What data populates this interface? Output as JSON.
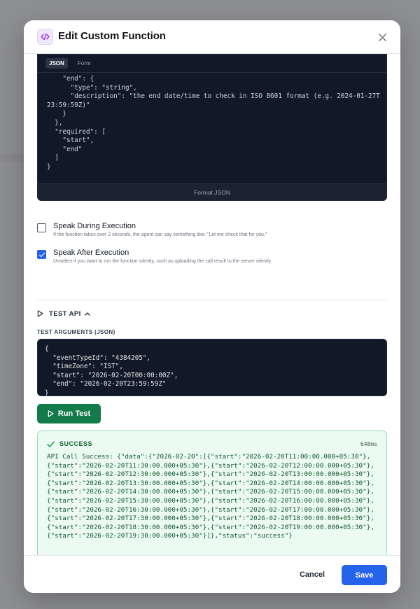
{
  "dialog": {
    "title": "Edit Custom Function",
    "icon": "code-icon",
    "accent": "#9333ea"
  },
  "schema_editor": {
    "tabs": [
      {
        "label": "JSON",
        "active": true
      },
      {
        "label": "Form",
        "active": false
      }
    ],
    "code": "    \"end\": {\n      \"type\": \"string\",\n      \"description\": \"the end date/time to check in ISO 8601 format (e.g. 2024-01-27T23:59:59Z)\"\n    }\n  },\n  \"required\": [\n    \"start\",\n    \"end\"\n  ]\n}",
    "format_label": "Format JSON"
  },
  "options": [
    {
      "label": "Speak During Execution",
      "description": "If the function takes over 2 seconds, the agent can say something like: \"Let me check that for you.\"",
      "checked": false
    },
    {
      "label": "Speak After Execution",
      "description": "Unselect if you want to run the function silently, such as uploading the call result to the server silently.",
      "checked": true
    }
  ],
  "test_api": {
    "toggle_label": "TEST API",
    "args_label": "TEST ARGUMENTS (JSON)",
    "args_code": "{\n  \"eventTypeId\": \"4384205\",\n  \"timeZone\": \"IST\",\n  \"start\": \"2026-02-20T00:00:00Z\",\n  \"end\": \"2026-02-20T23:59:59Z\"\n}",
    "run_label": "Run Test",
    "result": {
      "status": "SUCCESS",
      "duration": "648ms",
      "body": "API Call Success: {\"data\":{\"2026-02-20\":[{\"start\":\"2026-02-20T11:00:00.000+05:30\"},{\"start\":\"2026-02-20T11:30:00.000+05:30\"},{\"start\":\"2026-02-20T12:00:00.000+05:30\"},{\"start\":\"2026-02-20T12:30:00.000+05:30\"},{\"start\":\"2026-02-20T13:00:00.000+05:30\"},{\"start\":\"2026-02-20T13:30:00.000+05:30\"},{\"start\":\"2026-02-20T14:00:00.000+05:30\"},{\"start\":\"2026-02-20T14:30:00.000+05:30\"},{\"start\":\"2026-02-20T15:00:00.000+05:30\"},{\"start\":\"2026-02-20T15:30:00.000+05:30\"},{\"start\":\"2026-02-20T16:00:00.000+05:30\"},{\"start\":\"2026-02-20T16:30:00.000+05:30\"},{\"start\":\"2026-02-20T17:00:00.000+05:30\"},{\"start\":\"2026-02-20T17:30:00.000+05:30\"},{\"start\":\"2026-02-20T18:00:00.000+05:30\"},{\"start\":\"2026-02-20T18:30:00.000+05:30\"},{\"start\":\"2026-02-20T19:00:00.000+05:30\"},{\"start\":\"2026-02-20T19:30:00.000+05:30\"}]},\"status\":\"success\"}"
    }
  },
  "footer": {
    "cancel_label": "Cancel",
    "save_label": "Save"
  },
  "colors": {
    "primary": "#2563eb",
    "run": "#137a4a",
    "success_bg": "#ebfbf1",
    "editor_bg": "#111827"
  }
}
